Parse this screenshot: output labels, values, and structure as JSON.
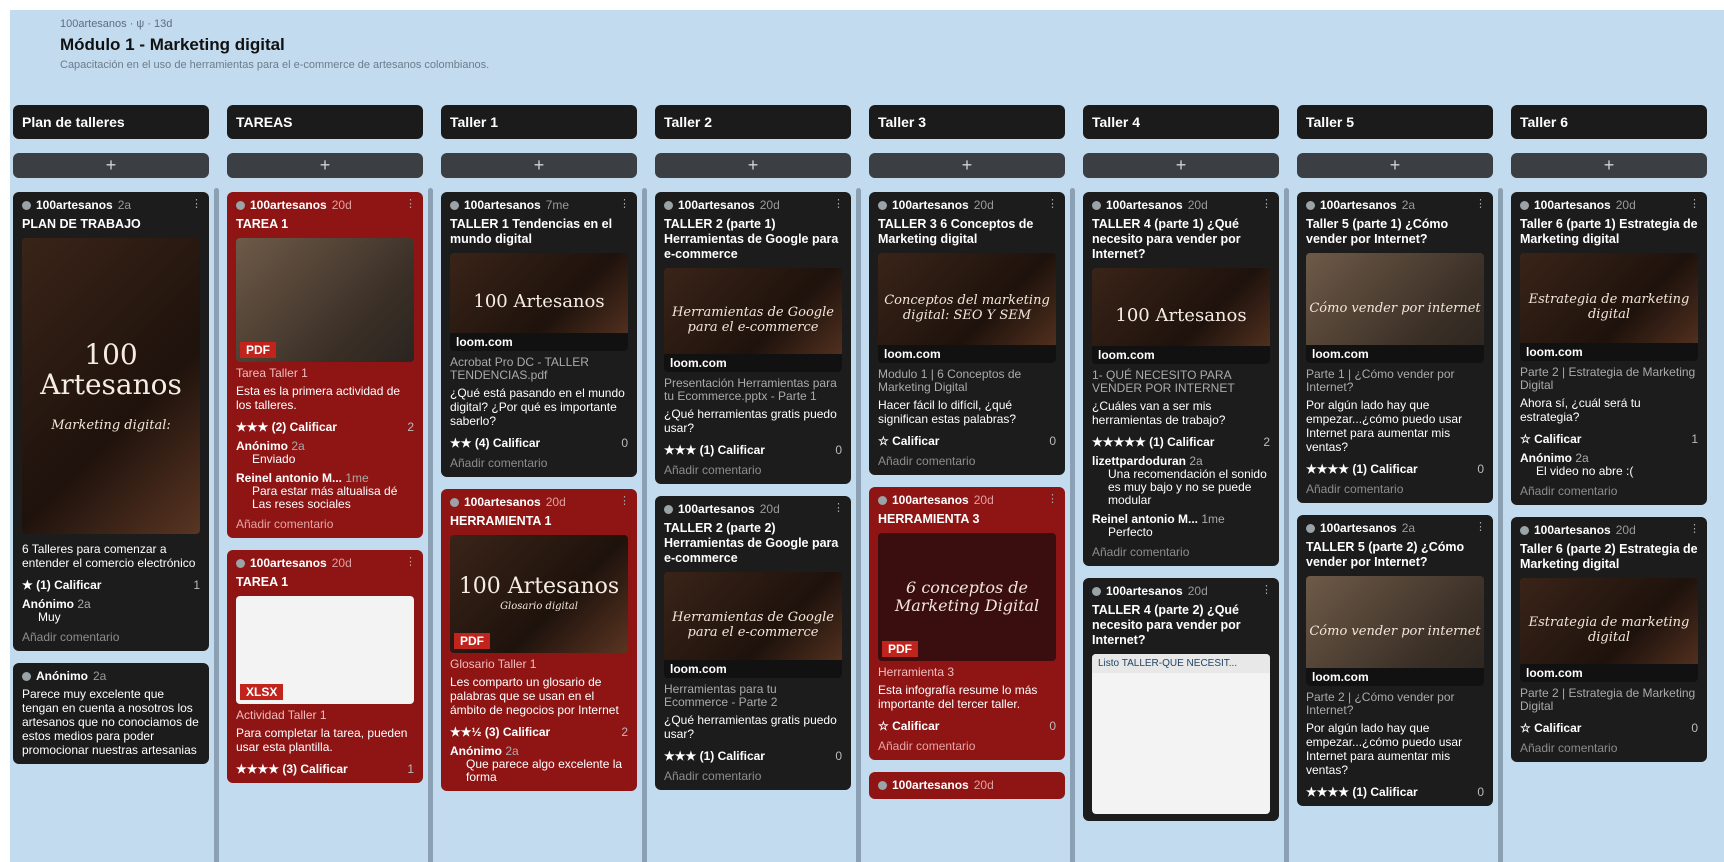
{
  "board": {
    "meta": "100artesanos · ψ · 13d",
    "title": "Módulo 1 - Marketing digital",
    "description": "Capacitación en el uso de herramientas para el e-commerce de artesanos colombianos."
  },
  "add_label": "+",
  "colors": {
    "background": "#c3dbee",
    "card_dark": "#1c1c1c",
    "card_red": "#8f1515",
    "badge_red": "#c0241d"
  },
  "columns": [
    {
      "title": "Plan de talleres"
    },
    {
      "title": "TAREAS"
    },
    {
      "title": "Taller 1"
    },
    {
      "title": "Taller 2"
    },
    {
      "title": "Taller 3"
    },
    {
      "title": "Taller 4"
    },
    {
      "title": "Taller 5"
    },
    {
      "title": "Taller 6"
    }
  ],
  "c0": {
    "card1": {
      "author": "100artesanos",
      "time": "2a",
      "title": "PLAN DE TRABAJO",
      "thumb_big": "100 Artesanos",
      "thumb_text": "Marketing digital:",
      "body": "6 Talleres para comenzar a entender el comercio electrónico",
      "rating": "★ (1) Calificar",
      "comments": "1",
      "c1_author": "Anónimo",
      "c1_time": "2a",
      "c1_text": "Muy",
      "add_comment": "Añadir comentario"
    },
    "card2": {
      "author": "Anónimo",
      "time": "2a",
      "body": "Parece muy excelente que tengan en cuenta a nosotros los artesanos que no conociamos de estos medios para poder promocionar nuestras artesanias"
    }
  },
  "c1": {
    "card1": {
      "author": "100artesanos",
      "time": "20d",
      "title": "TAREA 1",
      "badge": "PDF",
      "sub": "Tarea Taller 1",
      "body": "Esta es la primera actividad de los talleres.",
      "rating": "★★★ (2) Calificar",
      "comments": "2",
      "c1_author": "Anónimo",
      "c1_time": "2a",
      "c1_text": "Enviado",
      "c2_author": "Reinel antonio M...",
      "c2_time": "1me",
      "c2_text": "Para estar más altualisa dé Las reses sociales",
      "add_comment": "Añadir comentario"
    },
    "card2": {
      "author": "100artesanos",
      "time": "20d",
      "title": "TAREA 1",
      "badge": "XLSX",
      "sub": "Actividad Taller 1",
      "body": "Para completar la tarea, pueden usar esta plantilla.",
      "rating": "★★★★ (3) Calificar",
      "comments": "1"
    }
  },
  "c2": {
    "card1": {
      "author": "100artesanos",
      "time": "7me",
      "title": "TALLER 1 Tendencias en el mundo digital",
      "thumb_big": "100 Artesanos",
      "brand": "loom.com",
      "sub": "Acrobat Pro DC - TALLER TENDENCIAS.pdf",
      "body": "¿Qué está pasando en el mundo digital? ¿Por qué es importante saberlo?",
      "rating": "★★ (4) Calificar",
      "comments": "0",
      "add_comment": "Añadir comentario"
    },
    "card2": {
      "author": "100artesanos",
      "time": "20d",
      "title": "HERRAMIENTA 1",
      "thumb_big": "100 Artesanos",
      "thumb_text": "Glosario digital",
      "badge": "PDF",
      "sub": "Glosario Taller 1",
      "body": "Les comparto un glosario de palabras que se usan en el ámbito de negocios por Internet",
      "rating": "★★½ (3) Calificar",
      "comments": "2",
      "c1_author": "Anónimo",
      "c1_time": "2a",
      "c1_text": "Que parece algo excelente la forma"
    }
  },
  "c3": {
    "card1": {
      "author": "100artesanos",
      "time": "20d",
      "title": "TALLER 2 (parte 1) Herramientas de Google para e-commerce",
      "thumb_text": "Herramientas de Google para el e-commerce",
      "brand": "loom.com",
      "sub": "Presentación Herramientas para tu Ecommerce.pptx - Parte 1",
      "body": "¿Qué herramientas gratis puedo usar?",
      "rating": "★★★ (1) Calificar",
      "comments": "0",
      "add_comment": "Añadir comentario"
    },
    "card2": {
      "author": "100artesanos",
      "time": "20d",
      "title": "TALLER 2 (parte 2) Herramientas de Google para e-commerce",
      "thumb_text": "Herramientas de Google para el e-commerce",
      "brand": "loom.com",
      "sub": "Herramientas para tu Ecommerce - Parte 2",
      "body": "¿Qué herramientas gratis puedo usar?",
      "rating": "★★★ (1) Calificar",
      "comments": "0",
      "add_comment": "Añadir comentario"
    }
  },
  "c4": {
    "card1": {
      "author": "100artesanos",
      "time": "20d",
      "title": "TALLER 3 6 Conceptos de Marketing digital",
      "thumb_text": "Conceptos del marketing digital: SEO Y SEM",
      "brand": "loom.com",
      "sub": "Modulo 1 | 6 Conceptos de Marketing Digital",
      "body": "Hacer fácil lo difícil, ¿qué significan estas palabras?",
      "rating": "☆ Calificar",
      "comments": "0",
      "add_comment": "Añadir comentario"
    },
    "card2": {
      "author": "100artesanos",
      "time": "20d",
      "title": "HERRAMIENTA 3",
      "thumb_text": "6 conceptos de Marketing Digital",
      "badge": "PDF",
      "sub": "Herramienta 3",
      "body": "Esta infografía resume lo más importante del tercer taller.",
      "rating": "☆ Calificar",
      "comments": "0",
      "add_comment": "Añadir comentario"
    },
    "card3": {
      "author": "100artesanos",
      "time": "20d"
    }
  },
  "c5": {
    "card1": {
      "author": "100artesanos",
      "time": "20d",
      "title": "TALLER 4 (parte 1) ¿Qué necesito para vender por Internet?",
      "thumb_big": "100 Artesanos",
      "brand": "loom.com",
      "sub": "1- QUÉ NECESITO PARA VENDER POR INTERNET",
      "body": "¿Cuáles van a ser mis herramientas de trabajo?",
      "rating": "★★★★★ (1) Calificar",
      "comments": "2",
      "c1_author": "lizettpardoduran",
      "c1_time": "2a",
      "c1_text": "Una recomendación el sonido es muy bajo y no se puede modular",
      "c2_author": "Reinel antonio M...",
      "c2_time": "1me",
      "c2_text": "Perfecto",
      "add_comment": "Añadir comentario"
    },
    "card2": {
      "author": "100artesanos",
      "time": "20d",
      "title": "TALLER 4 (parte 2) ¿Qué necesito para vender por Internet?",
      "phone_bar": "Listo  TALLER-QUE NECESIT..."
    }
  },
  "c6": {
    "card1": {
      "author": "100artesanos",
      "time": "2a",
      "title": "Taller 5 (parte 1) ¿Cómo vender por Internet?",
      "thumb_text": "Cómo vender por internet",
      "brand": "loom.com",
      "sub": "Parte 1 | ¿Cómo vender por Internet?",
      "body": "Por algún lado hay que empezar...¿cómo puedo usar Internet para aumentar mis ventas?",
      "rating": "★★★★ (1) Calificar",
      "comments": "0",
      "add_comment": "Añadir comentario"
    },
    "card2": {
      "author": "100artesanos",
      "time": "2a",
      "title": "TALLER 5 (parte 2) ¿Cómo vender por Internet?",
      "thumb_text": "Cómo vender por internet",
      "brand": "loom.com",
      "sub": "Parte 2 | ¿Cómo vender por Internet?",
      "body": "Por algún lado hay que empezar...¿cómo puedo usar Internet para aumentar mis ventas?",
      "rating": "★★★★ (1) Calificar",
      "comments": "0"
    }
  },
  "c7": {
    "card1": {
      "author": "100artesanos",
      "time": "20d",
      "title": "Taller 6 (parte 1) Estrategia de Marketing digital",
      "thumb_text": "Estrategia de marketing digital",
      "brand": "loom.com",
      "sub": "Parte 2 | Estrategia de Marketing Digital",
      "body": "Ahora sí, ¿cuál será tu estrategia?",
      "rating": "☆ Calificar",
      "comments": "1",
      "c1_author": "Anónimo",
      "c1_time": "2a",
      "c1_text": "El video no abre :(",
      "add_comment": "Añadir comentario"
    },
    "card2": {
      "author": "100artesanos",
      "time": "20d",
      "title": "Taller 6 (parte 2) Estrategia de Marketing digital",
      "thumb_text": "Estrategia de marketing digital",
      "brand": "loom.com",
      "sub": "Parte 2 | Estrategia de Marketing Digital",
      "rating": "☆ Calificar",
      "comments": "0",
      "add_comment": "Añadir comentario"
    }
  }
}
